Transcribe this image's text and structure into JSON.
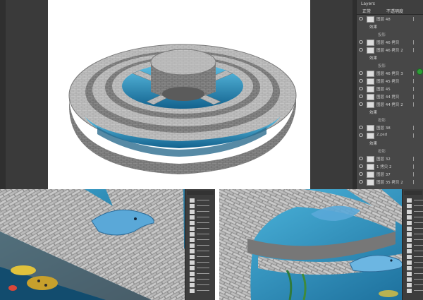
{
  "top_panel": {
    "layers_panel": {
      "tab_label": "Layers",
      "mode_label": "正常",
      "opacity_label": "不透明度",
      "layers": [
        {
          "name": "图层 48",
          "kind": "layer"
        },
        {
          "name": "效果",
          "kind": "sub"
        },
        {
          "name": "投影",
          "kind": "fx"
        },
        {
          "name": "图层 46 拷贝",
          "kind": "layer"
        },
        {
          "name": "图层 46 拷贝 2",
          "kind": "layer"
        },
        {
          "name": "效果",
          "kind": "sub"
        },
        {
          "name": "投影",
          "kind": "fx"
        },
        {
          "name": "图层 46 拷贝 3",
          "kind": "layer"
        },
        {
          "name": "图层 45 拷贝",
          "kind": "layer"
        },
        {
          "name": "图层 45",
          "kind": "layer"
        },
        {
          "name": "图层 44 拷贝",
          "kind": "layer"
        },
        {
          "name": "图层 44 拷贝 2",
          "kind": "layer"
        },
        {
          "name": "效果",
          "kind": "sub"
        },
        {
          "name": "投影",
          "kind": "fx"
        },
        {
          "name": "图层 38",
          "kind": "layer"
        },
        {
          "name": "2.psd",
          "kind": "layer"
        },
        {
          "name": "效果",
          "kind": "sub"
        },
        {
          "name": "投影",
          "kind": "fx"
        },
        {
          "name": "图层 32",
          "kind": "layer"
        },
        {
          "name": "1 拷贝 2",
          "kind": "layer"
        },
        {
          "name": "图层 37",
          "kind": "layer"
        },
        {
          "name": "图层 35 拷贝 2",
          "kind": "layer"
        }
      ]
    }
  },
  "colors": {
    "ps_dark": "#3a3a3a",
    "panel_bg": "#474747",
    "water_blue": "#1f6f97",
    "stone_gray": "#9c9c9c",
    "accent_green": "#2e9e37"
  }
}
